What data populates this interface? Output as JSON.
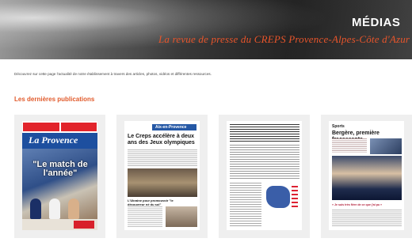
{
  "hero": {
    "title": "MÉDIAS",
    "subtitle": "La revue de presse du CREPS Provence-Alpes-Côte d'Azur"
  },
  "intro": {
    "text": "Découvrez sur cette page l'actualité de notre établissement à travers des articles, photos, vidéos et différentes ressources."
  },
  "section": {
    "title": "Les dernières publications"
  },
  "publications": [
    {
      "masthead": "La Provence",
      "headline": "\"Le match de l'année\""
    },
    {
      "section_tag": "Aix-en-Provence",
      "title": "Le Creps accélère à deux ans des Jeux olympiques",
      "subhead": "L'Ukraine pour promouvoir \"le découvreur né du sol\""
    },
    {
      "header": "AIX-EN-PROVENCE | Le site du CREPS Provence-Alpes-Côte d'Azur retenu comme base arrière"
    },
    {
      "rubric": "Sports",
      "title": "Bergère, première fracassante",
      "caption": "« Je suis très fière de ce que j'ai pu »"
    }
  ]
}
